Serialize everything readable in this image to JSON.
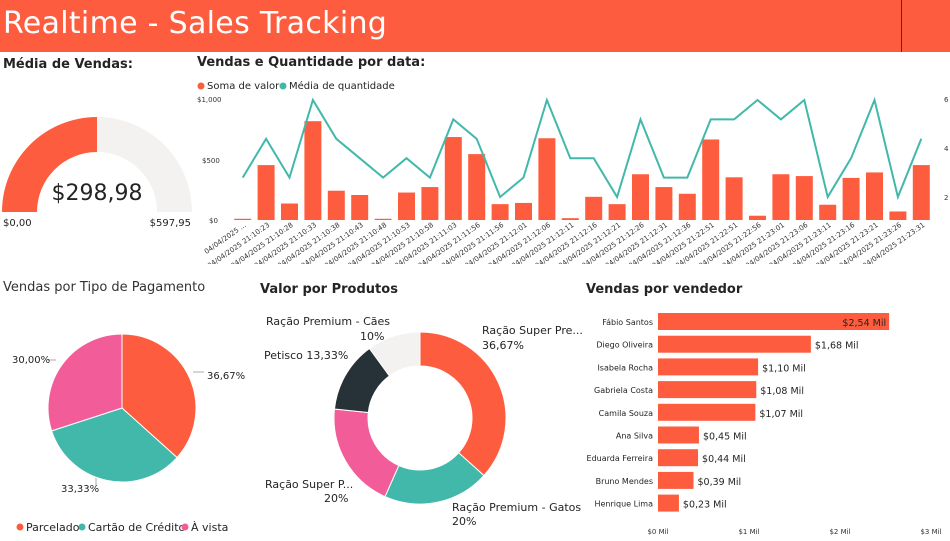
{
  "header": {
    "title": "Realtime - Sales Tracking"
  },
  "gauge": {
    "title": "Média de Vendas:",
    "value_label": "$298,98",
    "min_label": "$0,00",
    "max_label": "$597,95",
    "chart_data": {
      "type": "gauge",
      "value": 298.98,
      "min": 0,
      "max": 597.95
    }
  },
  "combo": {
    "title": "Vendas e Quantidade por data:",
    "legend": [
      "Soma de valor",
      "Média de quantidade"
    ],
    "left_ticks": [
      "$1,000",
      "$500",
      "$0"
    ],
    "right_ticks": [
      "6",
      "4",
      "2"
    ],
    "chart_data": {
      "type": "bar",
      "categories": [
        "04/04/2025 ...",
        "04/04/2025 21:10:23",
        "04/04/2025 21:10:28",
        "04/04/2025 21:10:33",
        "04/04/2025 21:10:38",
        "04/04/2025 21:10:43",
        "04/04/2025 21:10:48",
        "04/04/2025 21:10:53",
        "04/04/2025 21:10:58",
        "04/04/2025 21:11:03",
        "04/04/2025 21:11:56",
        "04/04/2025 21:11:56",
        "04/04/2025 21:12:01",
        "04/04/2025 21:12:06",
        "04/04/2025 21:12:11",
        "04/04/2025 21:12:16",
        "04/04/2025 21:12:21",
        "04/04/2025 21:12:26",
        "04/04/2025 21:12:31",
        "04/04/2025 21:12:36",
        "04/04/2025 21:22:51",
        "04/04/2025 21:22:51",
        "04/04/2025 21:22:56",
        "04/04/2025 21:23:01",
        "04/04/2025 21:23:06",
        "04/04/2025 21:23:11",
        "04/04/2025 21:23:16",
        "04/04/2025 21:23:21",
        "04/04/2025 21:23:26",
        "04/04/2025 21:23:31"
      ],
      "series": [
        {
          "name": "Soma de valor",
          "type": "bar",
          "axis": "left",
          "values": [
            10,
            450,
            135,
            810,
            240,
            205,
            10,
            225,
            270,
            680,
            540,
            130,
            140,
            670,
            15,
            190,
            130,
            375,
            270,
            215,
            660,
            350,
            35,
            375,
            360,
            125,
            345,
            390,
            70,
            450
          ]
        },
        {
          "name": "Média de quantidade",
          "type": "line",
          "axis": "right",
          "values": [
            2,
            4,
            2,
            6,
            4,
            3,
            2,
            3,
            2,
            5,
            4,
            1,
            2,
            6,
            3,
            3,
            1,
            5,
            2,
            2,
            5,
            5,
            6,
            5,
            6,
            1,
            3,
            6,
            1,
            4
          ]
        }
      ],
      "ylim_left": [
        0,
        1000
      ],
      "ylim_right": [
        0,
        6
      ]
    }
  },
  "payment": {
    "title": "Vendas por Tipo de Pagamento",
    "labels": [
      "36,67%",
      "33,33%",
      "30,00%"
    ],
    "legend": [
      "Parcelado",
      "Cartão de Crédito",
      "À vista"
    ],
    "chart_data": {
      "type": "pie",
      "categories": [
        "Parcelado",
        "Cartão de Crédito",
        "À vista"
      ],
      "values": [
        36.67,
        33.33,
        30.0
      ],
      "colors": [
        "#fd5d3e",
        "#41b8aa",
        "#f25c99"
      ]
    }
  },
  "products": {
    "title": "Valor por Produtos",
    "labels": [
      {
        "name": "Ração Super Pre...",
        "pct": "36,67%"
      },
      {
        "name": "Ração Premium - Gatos",
        "pct": "20%"
      },
      {
        "name": "Ração Super P...",
        "pct": "20%"
      },
      {
        "name": "Petisco 13,33%",
        "pct": ""
      },
      {
        "name": "Ração Premium - Cães",
        "pct": "10%"
      }
    ],
    "chart_data": {
      "type": "pie",
      "categories": [
        "Ração Super Pre...",
        "Ração Premium - Gatos",
        "Ração Super P...",
        "Petisco",
        "Ração Premium - Cães"
      ],
      "values": [
        36.67,
        20,
        20,
        13.33,
        10
      ],
      "colors": [
        "#fd5d3e",
        "#41b8aa",
        "#f25c99",
        "#263238",
        "#f3f2f1"
      ]
    }
  },
  "sellers": {
    "title": "Vendas por vendedor",
    "x_ticks": [
      "$0 Mil",
      "$1 Mil",
      "$2 Mil",
      "$3 Mil"
    ],
    "chart_data": {
      "type": "bar",
      "orientation": "horizontal",
      "categories": [
        "Fábio Santos",
        "Diego Oliveira",
        "Isabela Rocha",
        "Gabriela Costa",
        "Camila Souza",
        "Ana Silva",
        "Eduarda Ferreira",
        "Bruno Mendes",
        "Henrique Lima"
      ],
      "values": [
        2.54,
        1.68,
        1.1,
        1.08,
        1.07,
        0.45,
        0.44,
        0.39,
        0.23
      ],
      "value_labels": [
        "$2,54 Mil",
        "$1,68 Mil",
        "$1,10 Mil",
        "$1,08 Mil",
        "$1,07 Mil",
        "$0,45 Mil",
        "$0,44 Mil",
        "$0,39 Mil",
        "$0,23 Mil"
      ],
      "xlim": [
        0,
        3
      ]
    }
  }
}
